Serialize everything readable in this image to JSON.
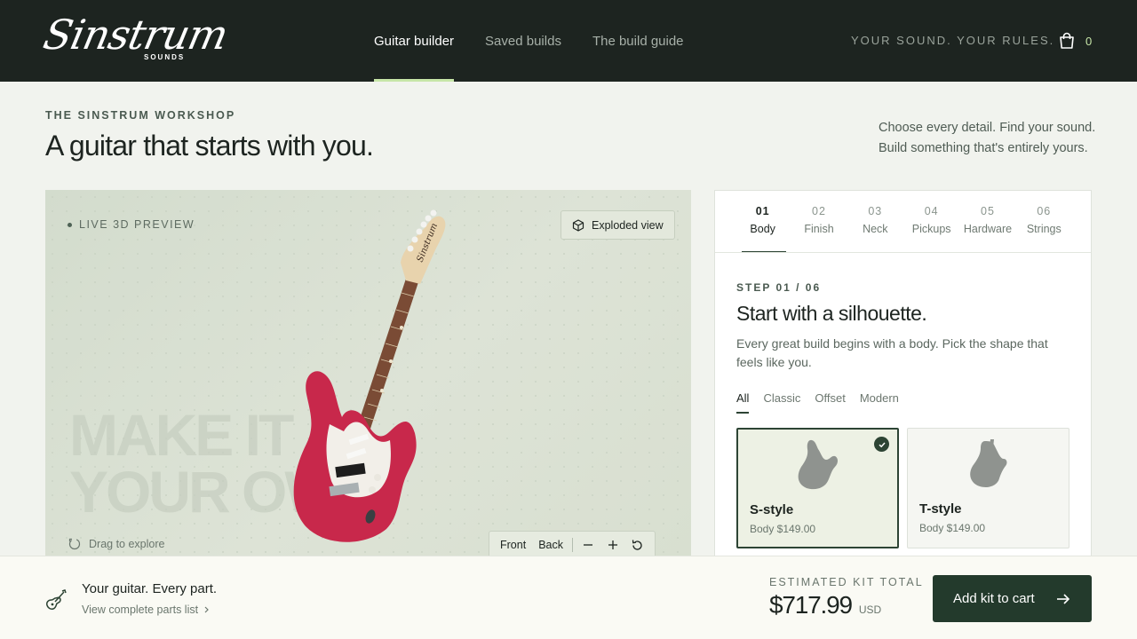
{
  "brand": {
    "name": "Sinstrum",
    "sub": "SOUNDS"
  },
  "nav": [
    {
      "label": "Guitar builder",
      "active": true
    },
    {
      "label": "Saved builds",
      "active": false
    },
    {
      "label": "The build guide",
      "active": false
    }
  ],
  "header": {
    "tagline": "YOUR SOUND. YOUR RULES.",
    "cart_count": "0"
  },
  "hero": {
    "eyebrow": "THE SINSTRUM WORKSHOP",
    "title": "A guitar that starts with you.",
    "intro_line1": "Choose every detail. Find your sound.",
    "intro_line2": "Build something that's entirely yours."
  },
  "preview": {
    "live_label": "LIVE 3D PREVIEW",
    "exploded_label": "Exploded view",
    "watermark_line1": "MAKE IT",
    "watermark_line2": "YOUR OW",
    "drag_label": "Drag to explore",
    "front_label": "Front",
    "back_label": "Back",
    "headstock_text": "Sinstrum"
  },
  "steps": [
    {
      "num": "01",
      "label": "Body",
      "active": true
    },
    {
      "num": "02",
      "label": "Finish",
      "active": false
    },
    {
      "num": "03",
      "label": "Neck",
      "active": false
    },
    {
      "num": "04",
      "label": "Pickups",
      "active": false
    },
    {
      "num": "05",
      "label": "Hardware",
      "active": false
    },
    {
      "num": "06",
      "label": "Strings",
      "active": false
    }
  ],
  "step_detail": {
    "count": "STEP 01 / 06",
    "title": "Start with a silhouette.",
    "description": "Every great build begins with a body. Pick the shape that feels like you."
  },
  "filters": [
    {
      "label": "All",
      "active": true
    },
    {
      "label": "Classic",
      "active": false
    },
    {
      "label": "Offset",
      "active": false
    },
    {
      "label": "Modern",
      "active": false
    }
  ],
  "options": [
    {
      "name": "S-style",
      "price": "Body $149.00",
      "selected": true
    },
    {
      "name": "T-style",
      "price": "Body $149.00",
      "selected": false
    }
  ],
  "footer": {
    "title": "Your guitar. Every part.",
    "link": "View complete parts list",
    "estimate_label": "ESTIMATED KIT TOTAL",
    "total": "$717.99",
    "currency": "USD",
    "cta": "Add kit to cart"
  },
  "colors": {
    "header_bg": "#1d2420",
    "accent": "#c7e6a8",
    "primary": "#233a2c",
    "body_red": "#c8284b"
  }
}
